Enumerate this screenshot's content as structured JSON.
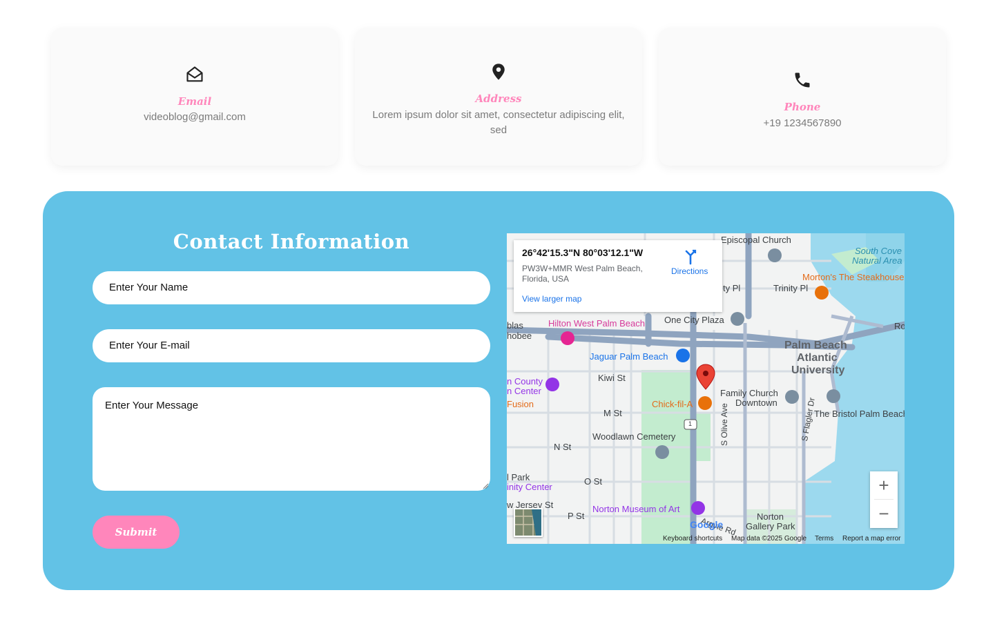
{
  "cards": [
    {
      "title": "Email",
      "text": "videoblog@gmail.com",
      "icon": "envelope-open-icon"
    },
    {
      "title": "Address",
      "text": "Lorem ipsum dolor sit amet, consectetur adipiscing elit, sed",
      "icon": "map-pin-icon"
    },
    {
      "title": "Phone",
      "text": "+19 1234567890",
      "icon": "phone-icon"
    }
  ],
  "contact": {
    "title": "Contact Information",
    "name_placeholder": "Enter Your Name",
    "email_placeholder": "Enter Your E-mail",
    "message_placeholder": "Enter Your Message",
    "submit_label": "Submit"
  },
  "map": {
    "coords": "26°42'15.3\"N 80°03'12.1\"W",
    "address": "PW3W+MMR West Palm Beach, Florida, USA",
    "directions_label": "Directions",
    "view_larger": "View larger map",
    "labels": {
      "episcopal": "Episcopal Church",
      "south_cove": "South Cove",
      "natural_area": "Natural Area",
      "trinity": "Trinity Pl",
      "ty_pl": "ty Pl",
      "mortons": "Morton's The Steakhouse",
      "hilton": "Hilton West Palm Beach",
      "one_city": "One City Plaza",
      "blas": "blas",
      "hobee": "hobee",
      "jaguar": "Jaguar Palm Beach",
      "pba1": "Palm Beach",
      "pba2": "Atlantic",
      "pba3": "University",
      "kiwi": "Kiwi St",
      "county1": "n County",
      "county2": "n Center",
      "fusion": "Fusion",
      "chick": "Chick-fil-A",
      "family1": "Family Church",
      "family2": "Downtown",
      "bristol": "The Bristol Palm Beach",
      "mst": "M St",
      "flagler": "S Flagler Dr",
      "woodlawn": "Woodlawn Cemetery",
      "nst": "N St",
      "olive": "S Olive Ave",
      "park1": "l Park",
      "park2": "inity Center",
      "ost": "O St",
      "jersey": "w Jersey St",
      "pst": "P St",
      "norton": "Norton Museum of Art",
      "ngp1": "Norton",
      "ngp2": "Gallery Park",
      "argyle": "Argyle Rd",
      "ro": "Ro",
      "route": "1"
    },
    "google": "Google",
    "attribution": {
      "keyboard": "Keyboard shortcuts",
      "mapdata": "Map data ©2025 Google",
      "terms": "Terms",
      "report": "Report a map error"
    },
    "zoom_in": "+",
    "zoom_out": "−"
  }
}
